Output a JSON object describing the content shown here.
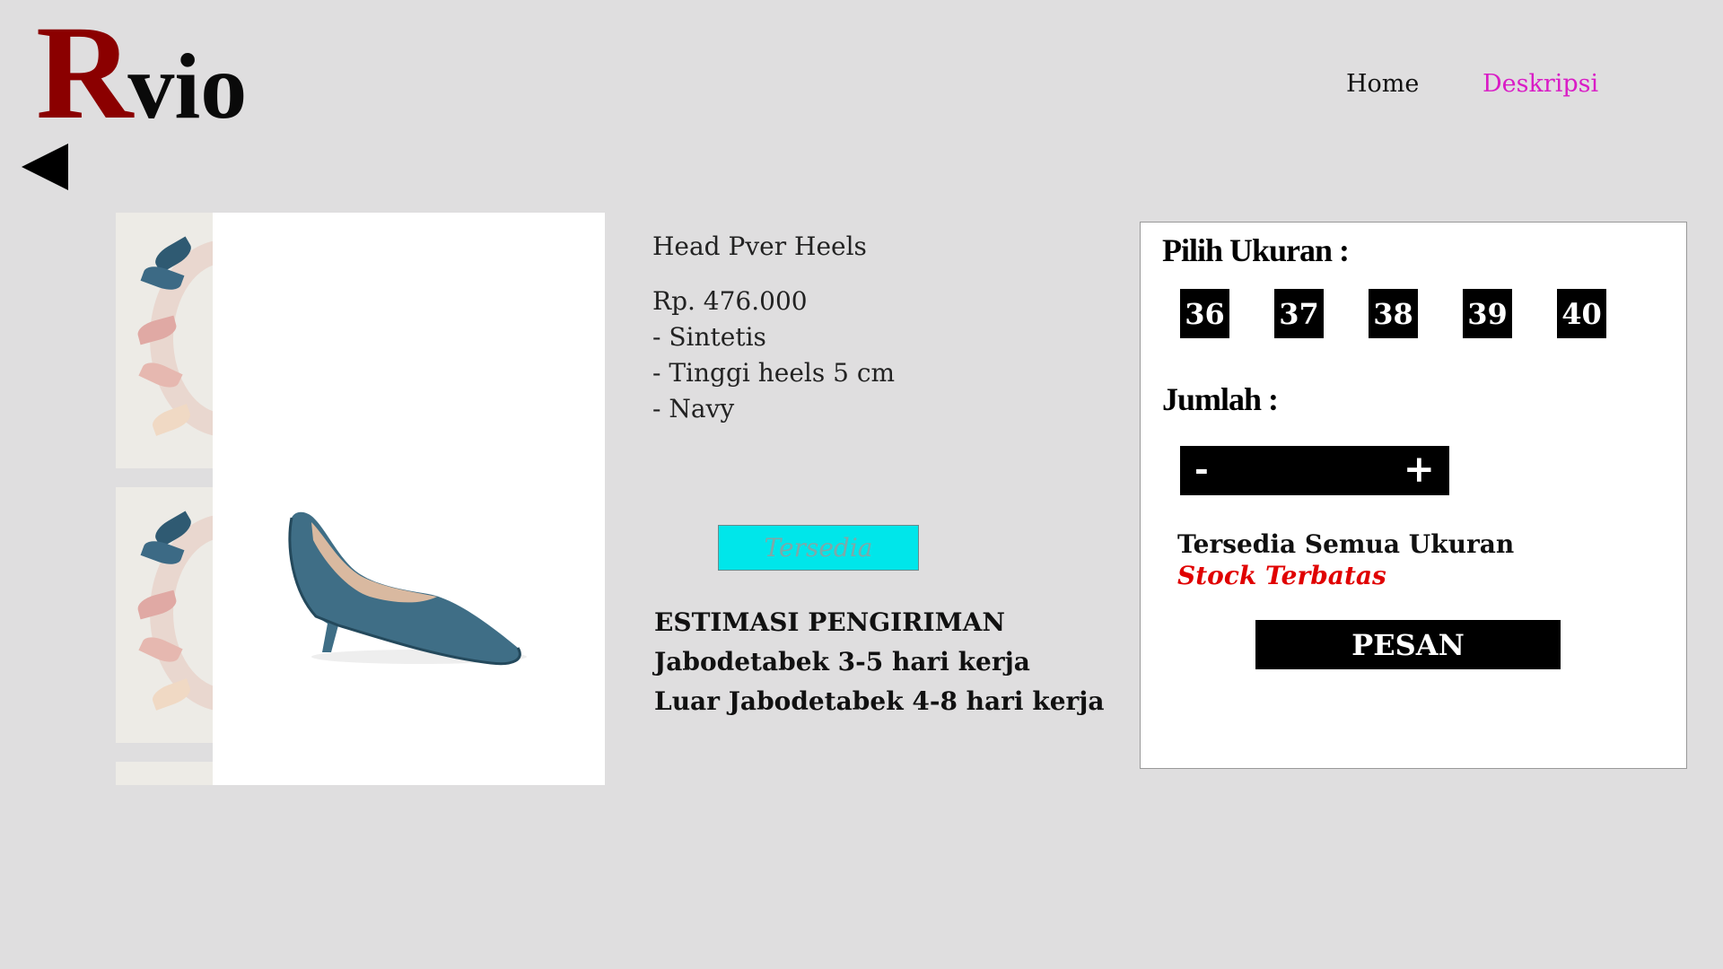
{
  "brand": {
    "logo_initial": "R",
    "logo_rest": "vio"
  },
  "nav": {
    "home": "Home",
    "deskripsi": "Deskripsi"
  },
  "product": {
    "name": "Head Pver Heels",
    "price": "Rp. 476.000",
    "features": [
      "- Sintetis",
      "- Tinggi heels 5 cm",
      "- Navy"
    ],
    "status": "Tersedia"
  },
  "shipping": {
    "title": "ESTIMASI PENGIRIMAN",
    "lines": [
      "Jabodetabek 3-5 hari kerja",
      "Luar Jabodetabek 4-8 hari kerja"
    ]
  },
  "order_panel": {
    "size_label": "Pilih Ukuran :",
    "sizes": [
      "36",
      "37",
      "38",
      "39",
      "40"
    ],
    "qty_label": "Jumlah :",
    "minus": "-",
    "plus": "+",
    "availability": "Tersedia Semua Ukuran",
    "stock": "Stock Terbatas",
    "order_button": "PESAN"
  },
  "colors": {
    "accent_pink": "#d91cc6",
    "logo_red": "#8b0000",
    "badge_cyan": "#00e6ea",
    "stock_red": "#e00000"
  },
  "icons": {
    "back": "back-arrow-icon"
  }
}
